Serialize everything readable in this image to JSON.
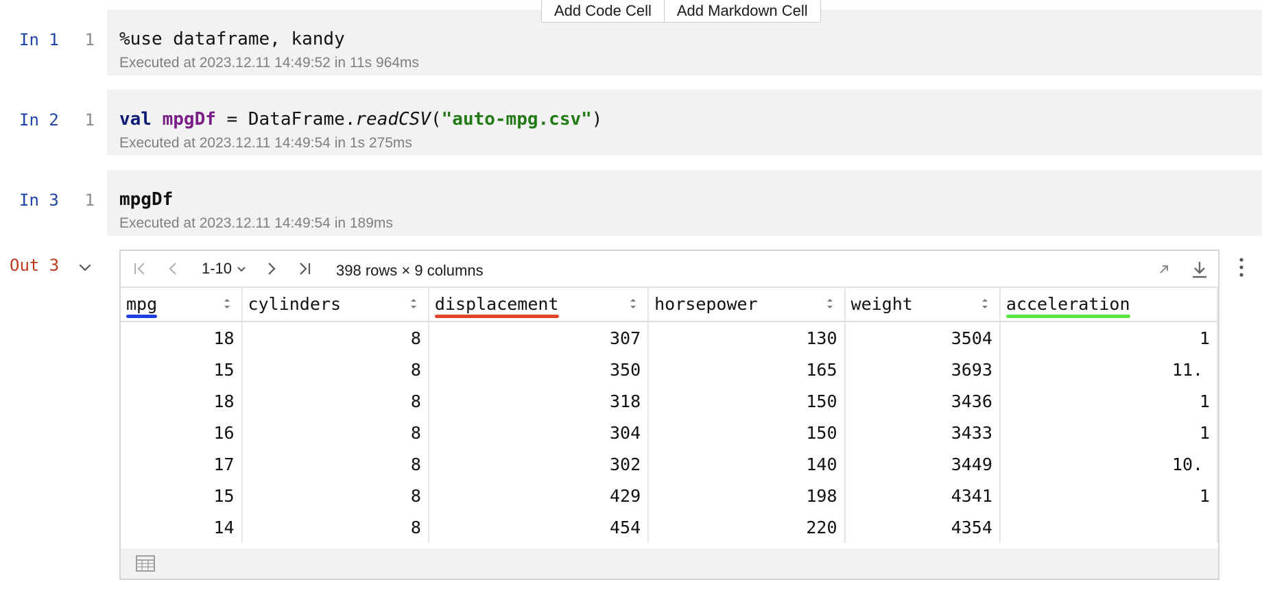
{
  "toolbar": {
    "add_code_label": "Add Code Cell",
    "add_markdown_label": "Add Markdown Cell"
  },
  "cells": [
    {
      "prompt": "In 1",
      "line": "1",
      "code": {
        "text": "%use dataframe, kandy"
      },
      "meta": "Executed at 2023.12.11 14:49:52 in 11s 964ms"
    },
    {
      "prompt": "In 2",
      "line": "1",
      "code": {
        "kw": "val",
        "var": "mpgDf",
        "eq": " = DataFrame.",
        "fn": "readCSV",
        "open": "(",
        "str": "\"auto-mpg.csv\"",
        "close": ")"
      },
      "meta": "Executed at 2023.12.11 14:49:54 in 1s 275ms"
    },
    {
      "prompt": "In 3",
      "line": "1",
      "code": {
        "var": "mpgDf"
      },
      "meta": "Executed at 2023.12.11 14:49:54 in 189ms"
    }
  ],
  "output": {
    "prompt": "Out 3",
    "pager": {
      "range": "1-10",
      "rows_info": "398 rows × 9 columns"
    },
    "columns": [
      "mpg",
      "cylinders",
      "displacement",
      "horsepower",
      "weight",
      "acceleration"
    ],
    "rows": [
      [
        "18",
        "8",
        "307",
        "130",
        "3504",
        "1"
      ],
      [
        "15",
        "8",
        "350",
        "165",
        "3693",
        "11."
      ],
      [
        "18",
        "8",
        "318",
        "150",
        "3436",
        "1"
      ],
      [
        "16",
        "8",
        "304",
        "150",
        "3433",
        "1"
      ],
      [
        "17",
        "8",
        "302",
        "140",
        "3449",
        "10."
      ],
      [
        "15",
        "8",
        "429",
        "198",
        "4341",
        "1"
      ],
      [
        "14",
        "8",
        "454",
        "220",
        "4354",
        ""
      ]
    ],
    "highlight_colors": {
      "mpg": "#1e3fe0",
      "displacement": "#e0432a",
      "acceleration": "#5be33f"
    },
    "icons": {
      "first": "first-page-icon",
      "prev": "previous-page-icon",
      "next": "next-page-icon",
      "last": "last-page-icon",
      "expand": "expand-icon",
      "download": "download-icon",
      "grid": "table-icon"
    }
  }
}
